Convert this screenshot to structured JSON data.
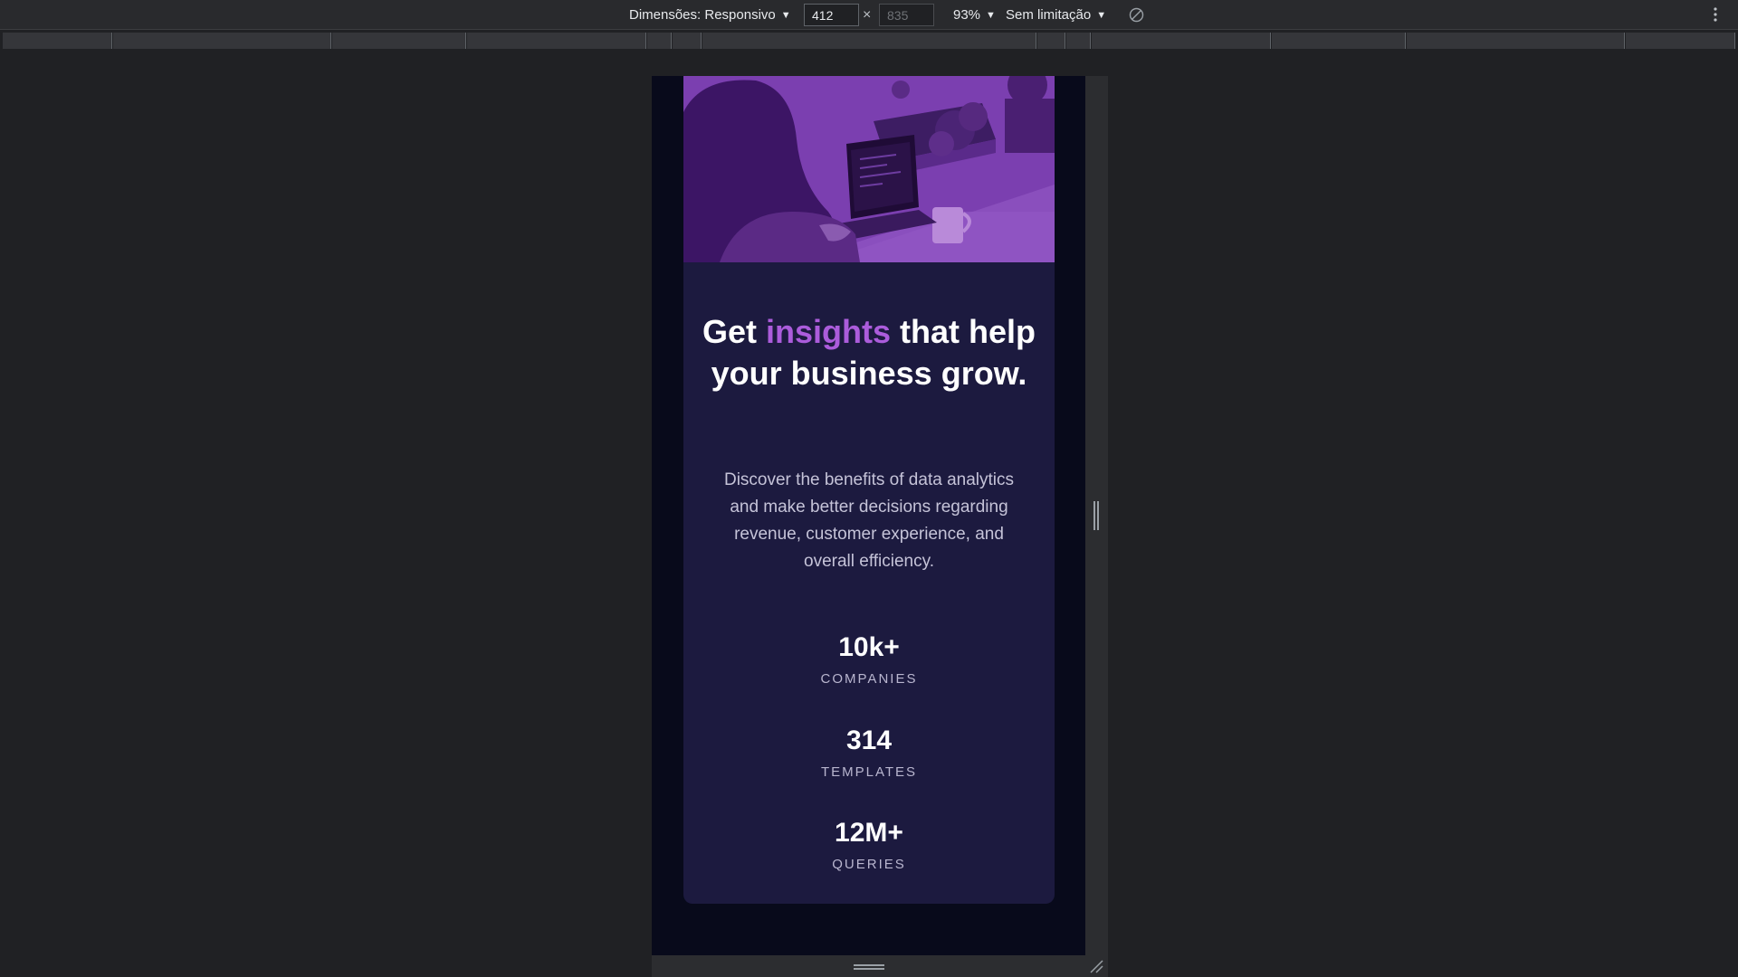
{
  "devtools": {
    "dimensions_label": "Dimensões: Responsivo",
    "width_value": "412",
    "height_placeholder": "835",
    "times_symbol": "×",
    "zoom_label": "93%",
    "throttle_label": "Sem limitação",
    "rotate_icon": "rotate-icon",
    "menu_icon": "kebab-menu-icon",
    "caret_symbol": "▼"
  },
  "page": {
    "hero_image_alt": "woman working on laptop",
    "headline_before": "Get ",
    "headline_accent": "insights",
    "headline_after": " that help your business grow.",
    "description": "Discover the benefits of data analytics and make better decisions regarding revenue, customer experience, and overall efficiency.",
    "stats": [
      {
        "value": "10k+",
        "label": "COMPANIES"
      },
      {
        "value": "314",
        "label": "TEMPLATES"
      },
      {
        "value": "12M+",
        "label": "QUERIES"
      }
    ]
  },
  "colors": {
    "accent": "#ab5cdb",
    "card_bg": "#1c1a3f",
    "page_bg": "#080a1b",
    "devtools_bg": "#202124"
  }
}
